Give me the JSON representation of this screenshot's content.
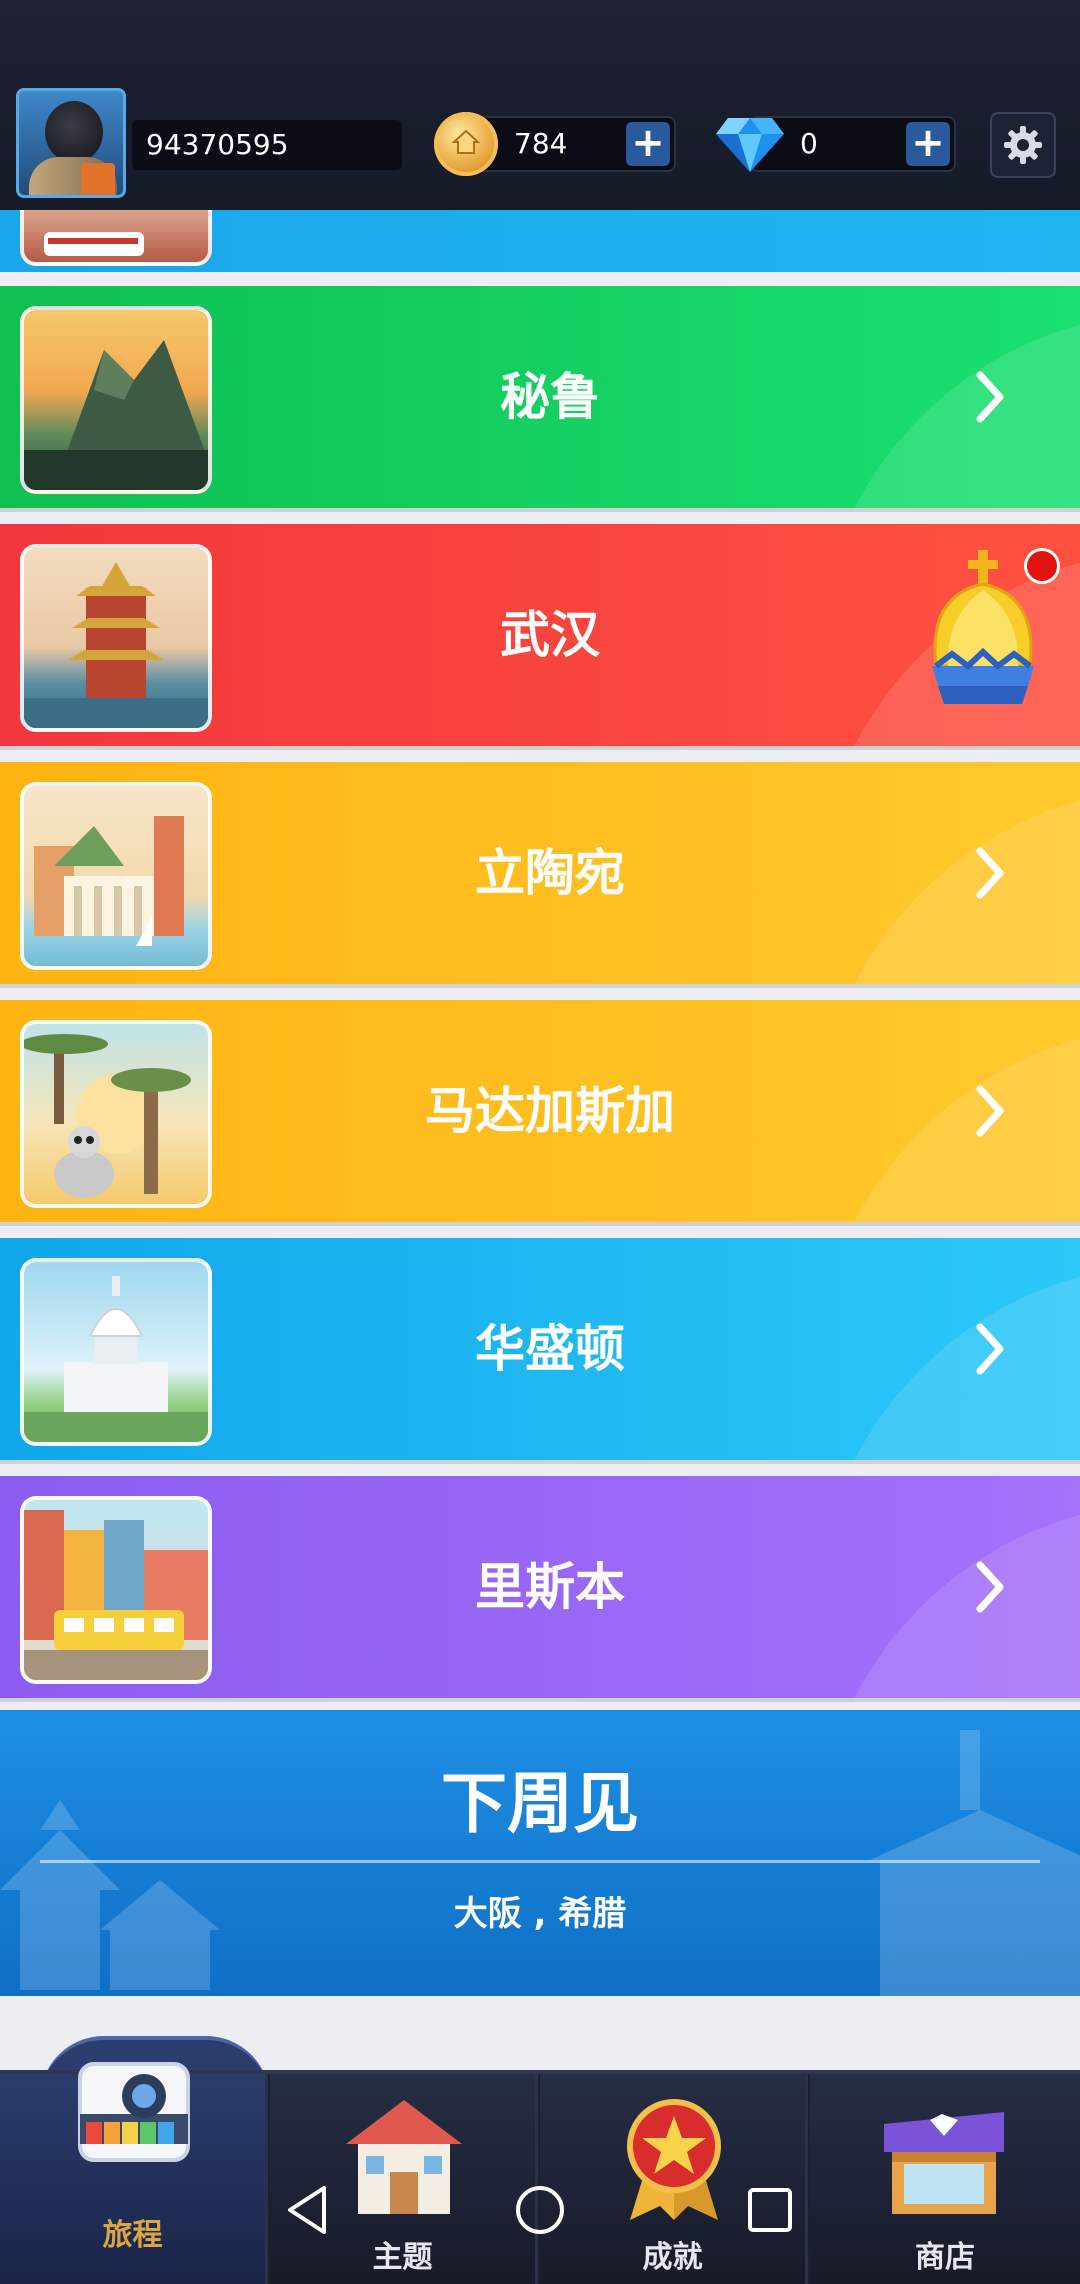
{
  "header": {
    "user_id": "94370595",
    "coins": "784",
    "gems": "0"
  },
  "destinations": [
    {
      "name": "秘鲁",
      "color_from": "#0fbf52",
      "color_to": "#19e070",
      "state": "available"
    },
    {
      "name": "武汉",
      "color_from": "#f2373c",
      "color_to": "#ff5140",
      "state": "current"
    },
    {
      "name": "立陶宛",
      "color_from": "#ffb411",
      "color_to": "#ffc92e",
      "state": "available"
    },
    {
      "name": "马达加斯加",
      "color_from": "#ffb411",
      "color_to": "#ffc92e",
      "state": "available"
    },
    {
      "name": "华盛顿",
      "color_from": "#10a7ea",
      "color_to": "#2dc8f8",
      "state": "available"
    },
    {
      "name": "里斯本",
      "color_from": "#8c5cf0",
      "color_to": "#a471fb",
      "state": "available"
    }
  ],
  "next_week": {
    "title": "下周见",
    "cities": "大阪 , 希腊"
  },
  "tabs": [
    {
      "label": "旅程",
      "icon": "camera-icon",
      "active": true
    },
    {
      "label": "主题",
      "icon": "house-icon",
      "active": false
    },
    {
      "label": "成就",
      "icon": "medal-icon",
      "active": false
    },
    {
      "label": "商店",
      "icon": "shop-icon",
      "active": false
    }
  ],
  "system_nav": [
    "back-icon",
    "home-icon",
    "recents-icon"
  ]
}
